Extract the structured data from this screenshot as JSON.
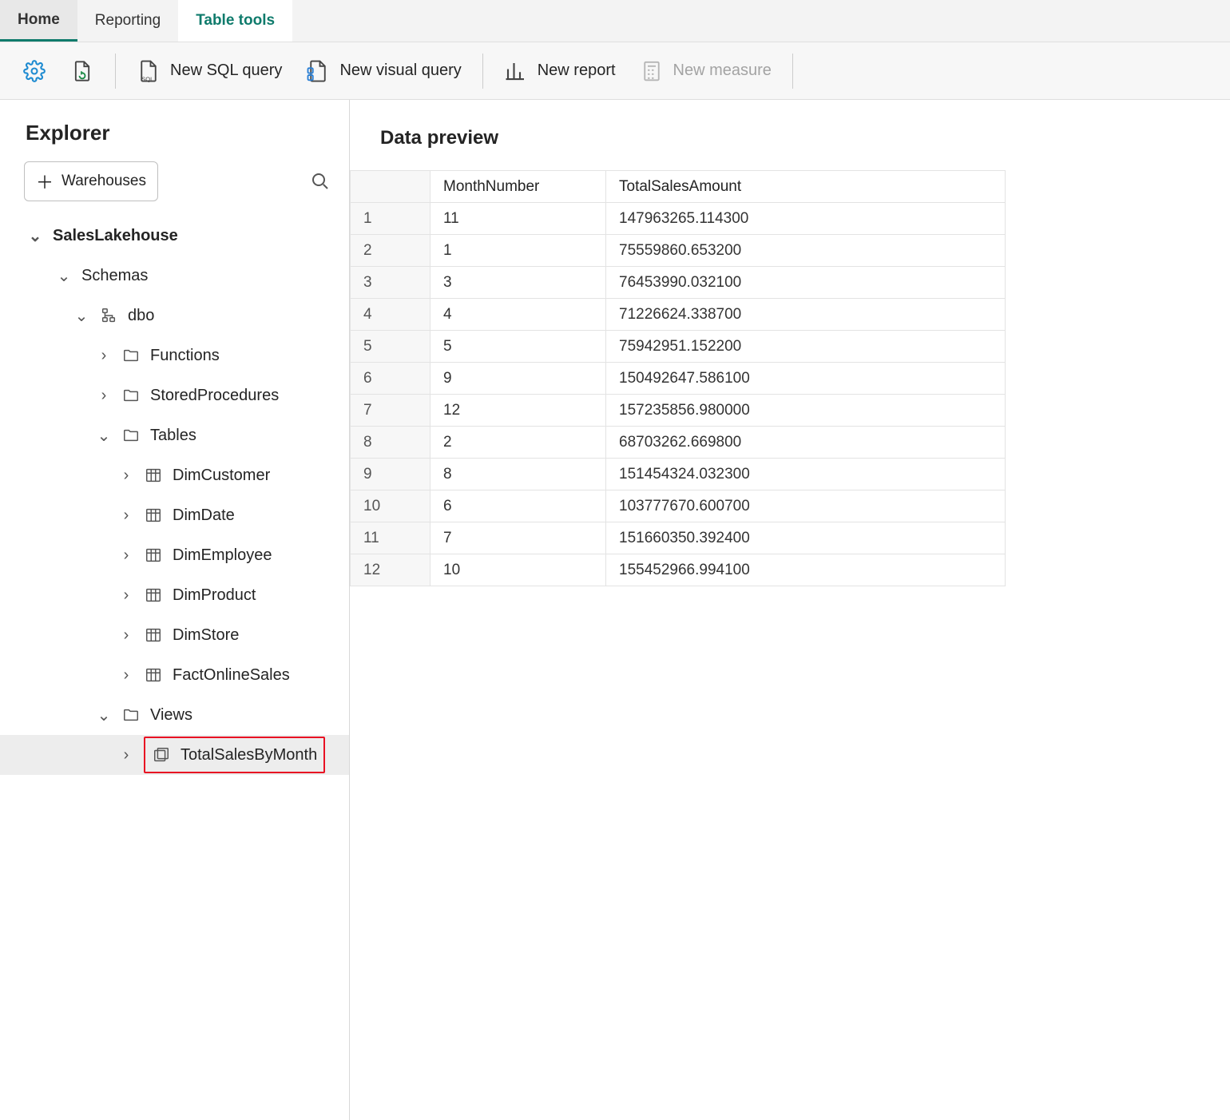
{
  "tabs": {
    "home": "Home",
    "reporting": "Reporting",
    "tools": "Table tools"
  },
  "ribbon": {
    "newSql": "New SQL query",
    "newVisual": "New visual query",
    "newReport": "New report",
    "newMeasure": "New measure"
  },
  "explorer": {
    "title": "Explorer",
    "warehouses": "Warehouses",
    "root": "SalesLakehouse",
    "schemas": "Schemas",
    "dbo": "dbo",
    "functions": "Functions",
    "storedProcs": "StoredProcedures",
    "tables": "Tables",
    "tableList": {
      "t0": "DimCustomer",
      "t1": "DimDate",
      "t2": "DimEmployee",
      "t3": "DimProduct",
      "t4": "DimStore",
      "t5": "FactOnlineSales"
    },
    "views": "Views",
    "view0": "TotalSalesByMonth"
  },
  "preview": {
    "title": "Data preview",
    "columns": {
      "c0": "MonthNumber",
      "c1": "TotalSalesAmount"
    },
    "rows": [
      {
        "n": "1",
        "m": "11",
        "t": "147963265.114300"
      },
      {
        "n": "2",
        "m": "1",
        "t": "75559860.653200"
      },
      {
        "n": "3",
        "m": "3",
        "t": "76453990.032100"
      },
      {
        "n": "4",
        "m": "4",
        "t": "71226624.338700"
      },
      {
        "n": "5",
        "m": "5",
        "t": "75942951.152200"
      },
      {
        "n": "6",
        "m": "9",
        "t": "150492647.586100"
      },
      {
        "n": "7",
        "m": "12",
        "t": "157235856.980000"
      },
      {
        "n": "8",
        "m": "2",
        "t": "68703262.669800"
      },
      {
        "n": "9",
        "m": "8",
        "t": "151454324.032300"
      },
      {
        "n": "10",
        "m": "6",
        "t": "103777670.600700"
      },
      {
        "n": "11",
        "m": "7",
        "t": "151660350.392400"
      },
      {
        "n": "12",
        "m": "10",
        "t": "155452966.994100"
      }
    ]
  }
}
